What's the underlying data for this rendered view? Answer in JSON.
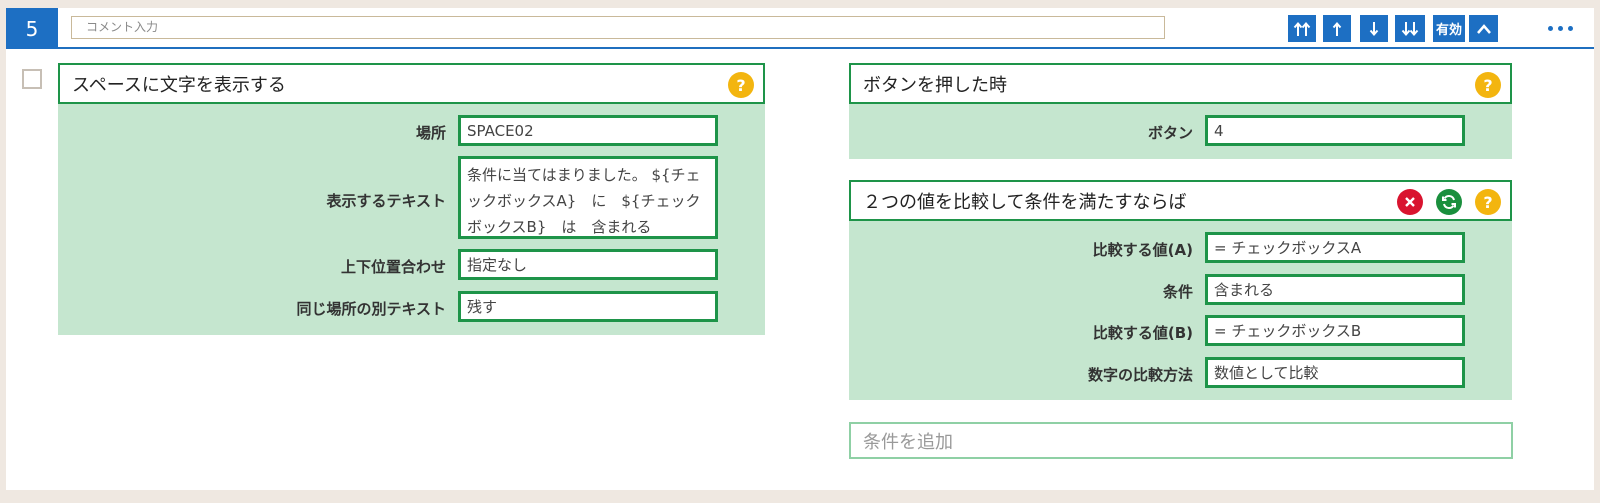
{
  "step": {
    "number": "5",
    "comment_placeholder": "コメント入力"
  },
  "toolbar": {
    "move_top_icon": "double-up-arrow-icon",
    "move_up_icon": "up-arrow-icon",
    "move_down_icon": "down-arrow-icon",
    "move_bottom_icon": "double-down-arrow-icon",
    "enabled_label": "有効",
    "collapse_icon": "chevron-up-icon",
    "more_icon": "more-dots-icon"
  },
  "action": {
    "title": "スペースに文字を表示する",
    "fields": [
      {
        "label": "場所",
        "value": "SPACE02"
      },
      {
        "label": "表示するテキスト",
        "value": "条件に当てはまりました。 ${チェックボックスA}　に　${チェックボックスB}　は　含まれる"
      },
      {
        "label": "上下位置合わせ",
        "value": "指定なし"
      },
      {
        "label": "同じ場所の別テキスト",
        "value": "残す"
      }
    ]
  },
  "trigger": {
    "title": "ボタンを押した時",
    "fields": [
      {
        "label": "ボタン",
        "value": "4"
      }
    ]
  },
  "condition": {
    "title": "２つの値を比較して条件を満たすならば",
    "fields": [
      {
        "label": "比較する値(A)",
        "value": "= チェックボックスA"
      },
      {
        "label": "条件",
        "value": "含まれる"
      },
      {
        "label": "比較する値(B)",
        "value": "= チェックボックスB"
      },
      {
        "label": "数字の比較方法",
        "value": "数値として比較"
      }
    ]
  },
  "add_condition": {
    "label": "条件を追加"
  },
  "colors": {
    "blue": "#1d6fc3",
    "green": "#1e9449",
    "panel": "#c5e6cf",
    "help": "#f3b50f",
    "delete": "#d9142f",
    "refresh": "#1a8f3d"
  }
}
